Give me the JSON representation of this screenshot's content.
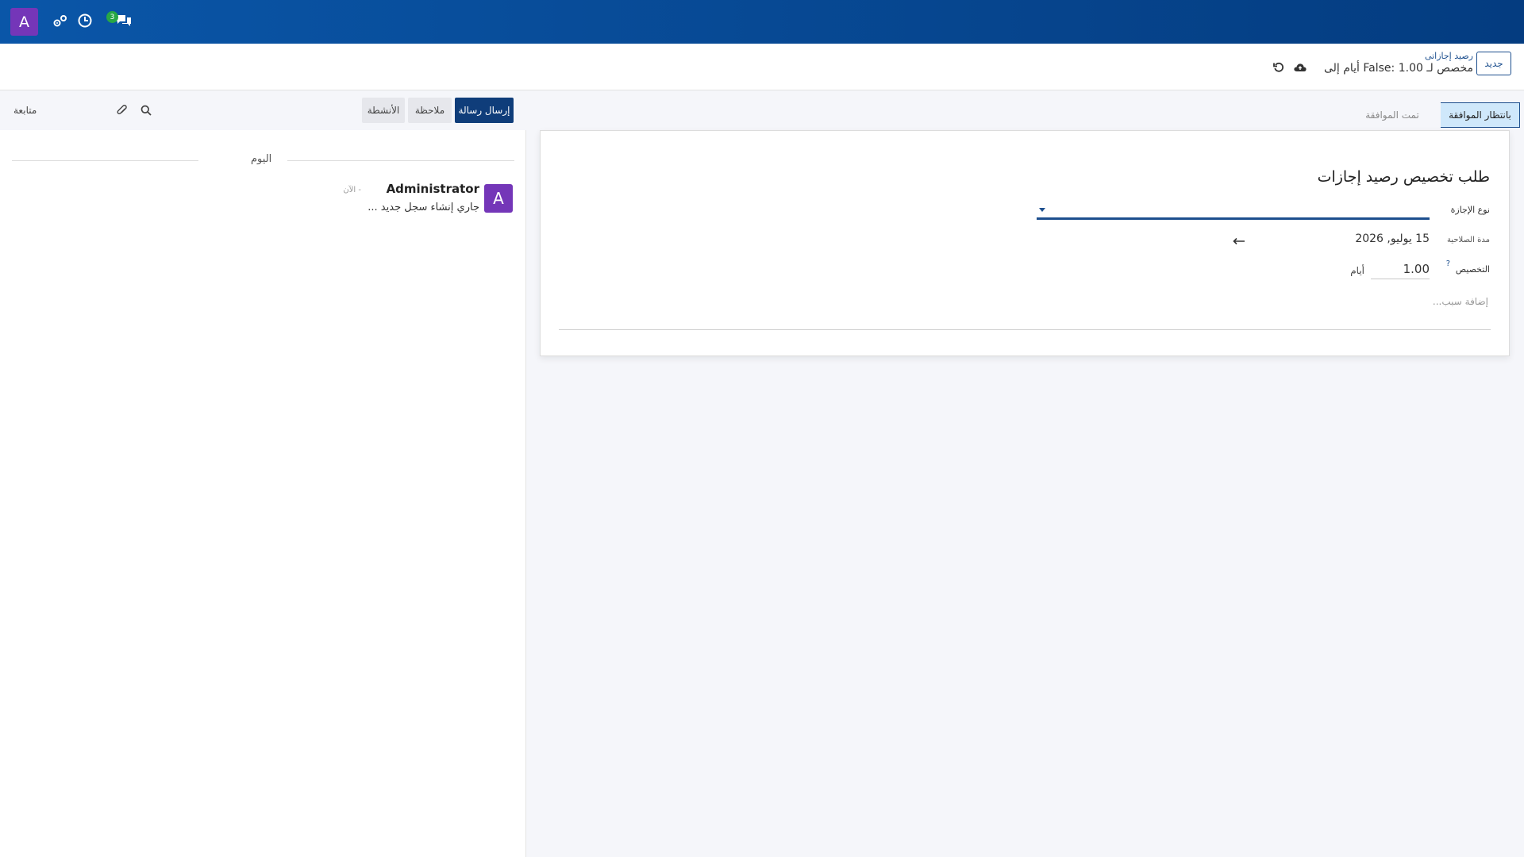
{
  "navbar": {
    "avatar_letter": "A",
    "badge_count": "3",
    "colors": {
      "background": "#0a56a8",
      "avatar": "#7436b8",
      "badge": "#28a745"
    }
  },
  "control_panel": {
    "new_button": "جديد",
    "breadcrumb_parent": "رصيد إجازاتى",
    "breadcrumb_current": "مخصص لـ False: 1.00 أيام إلى"
  },
  "statusbar": {
    "current": "بانتظار الموافقة",
    "next": "تمت الموافقة"
  },
  "form": {
    "title": "طلب تخصيص رصيد إجازات",
    "leave_type_label": "نوع الإجازة",
    "validity_label": "مدة الصلاحية",
    "validity_start": "15 يوليو, 2026",
    "allocation_label": "التخصيص",
    "help_mark": "?",
    "allocation_value": "1.00",
    "allocation_unit": "أيام",
    "reason_placeholder": "إضافة سبب..."
  },
  "chatter": {
    "send_message": "إرسال رسالة",
    "log_note": "ملاحظة",
    "activities": "الأنشطة",
    "follow": "متابعة",
    "today": "اليوم",
    "message": {
      "avatar_letter": "A",
      "author": "Administrator",
      "time": "- الآن",
      "body": "جاري إنشاء سجل جديد ..."
    }
  }
}
